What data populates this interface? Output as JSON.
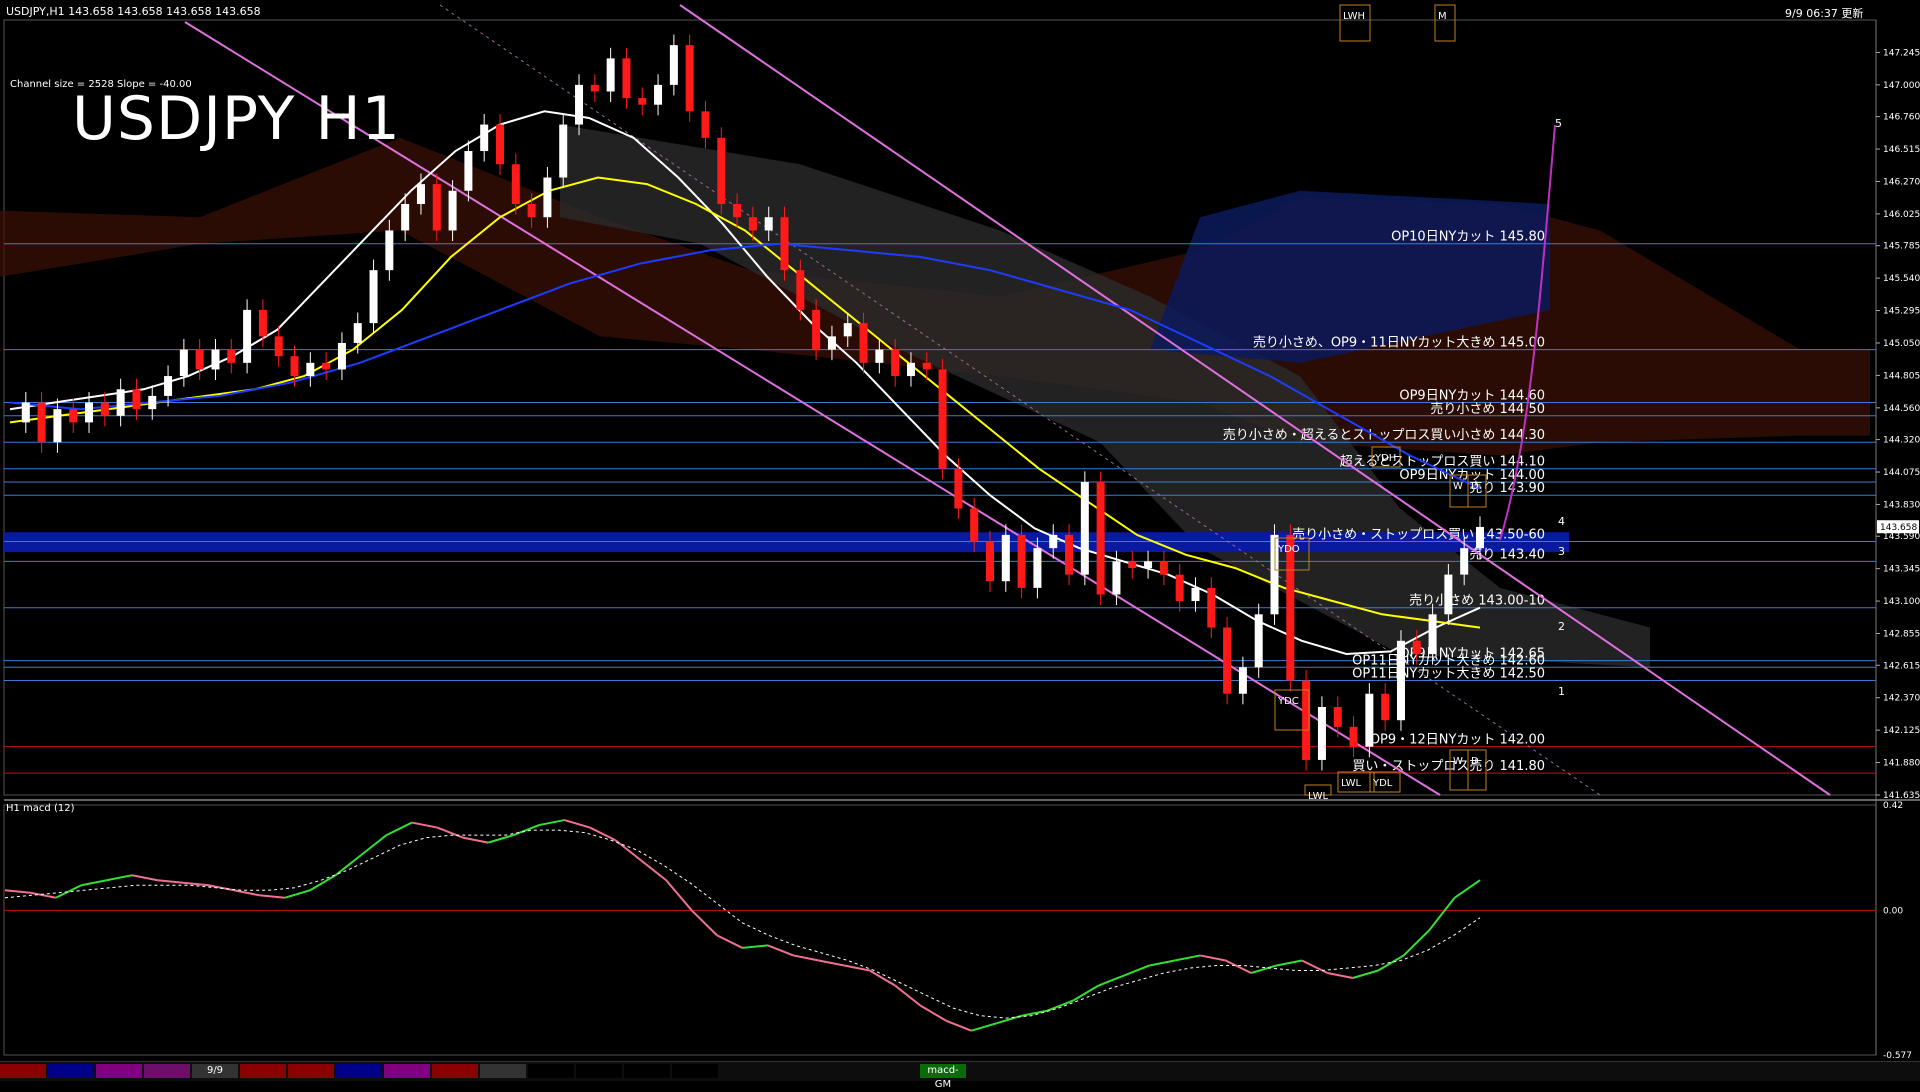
{
  "header": {
    "symbol_info": "USDJPY,H1  143.658 143.658 143.658 143.658",
    "datetime": "9/9 06:37 更新",
    "title": "USDJPY H1",
    "channel_info": "Channel size = 2528  Slope = -40.00"
  },
  "chart_data": [
    {
      "type": "line",
      "title": "USDJPY H1",
      "price_axis": {
        "range": [
          141.635,
          147.49
        ],
        "ticks": [
          "147.245",
          "147.000",
          "146.760",
          "146.515",
          "146.270",
          "146.025",
          "145.785",
          "145.540",
          "145.295",
          "145.050",
          "144.805",
          "144.560",
          "144.320",
          "144.075",
          "143.830",
          "143.590",
          "143.345",
          "143.100",
          "142.855",
          "142.615",
          "142.370",
          "142.125",
          "141.880",
          "141.635"
        ],
        "current_price": "143.658"
      },
      "price_path": [
        144.45,
        144.6,
        144.3,
        144.55,
        144.45,
        144.6,
        144.5,
        144.7,
        144.55,
        144.65,
        144.8,
        145.0,
        144.85,
        145.0,
        144.9,
        145.3,
        145.1,
        144.95,
        144.8,
        144.9,
        144.85,
        145.05,
        145.2,
        145.6,
        145.9,
        146.1,
        146.25,
        145.9,
        146.2,
        146.5,
        146.7,
        146.4,
        146.1,
        146.0,
        146.3,
        146.7,
        147.0,
        146.95,
        147.2,
        146.9,
        146.85,
        147.0,
        147.3,
        146.8,
        146.6,
        146.1,
        146.0,
        145.9,
        146.0,
        145.6,
        145.3,
        145.0,
        145.1,
        145.2,
        144.9,
        145.0,
        144.8,
        144.9,
        144.85,
        144.1,
        143.8,
        143.55,
        143.25,
        143.6,
        143.2,
        143.5,
        143.6,
        143.3,
        144.0,
        143.15,
        143.4,
        143.35,
        143.4,
        143.3,
        143.1,
        143.2,
        142.9,
        142.4,
        142.6,
        143.0,
        143.6,
        142.5,
        141.9,
        142.3,
        142.15,
        142.0,
        142.4,
        142.2,
        142.8,
        142.7,
        143.0,
        143.3,
        143.5,
        143.66
      ],
      "series": [
        {
          "color": "#ffffff",
          "values": [
            144.55,
            144.6,
            144.65,
            144.7,
            144.8,
            144.95,
            145.15,
            145.5,
            145.85,
            146.2,
            146.5,
            146.7,
            146.8,
            146.75,
            146.6,
            146.3,
            145.95,
            145.55,
            145.2,
            144.9,
            144.55,
            144.2,
            143.9,
            143.65,
            143.5,
            143.4,
            143.3,
            143.15,
            142.95,
            142.8,
            142.7,
            142.72,
            142.9,
            143.05
          ]
        },
        {
          "color": "#ffff00",
          "values": [
            144.45,
            144.5,
            144.55,
            144.6,
            144.65,
            144.7,
            144.8,
            145.0,
            145.3,
            145.7,
            146.0,
            146.2,
            146.3,
            146.25,
            146.1,
            145.9,
            145.6,
            145.3,
            145.0,
            144.7,
            144.4,
            144.1,
            143.85,
            143.6,
            143.45,
            143.35,
            143.2,
            143.1,
            143.0,
            142.95,
            142.9
          ]
        },
        {
          "color": "#1e3cff",
          "values": [
            144.6,
            144.55,
            144.6,
            144.65,
            144.75,
            144.9,
            145.1,
            145.3,
            145.5,
            145.65,
            145.75,
            145.8,
            145.75,
            145.7,
            145.6,
            145.45,
            145.3,
            145.05,
            144.8,
            144.5,
            144.2,
            143.95
          ]
        }
      ],
      "levels": [
        {
          "label": "OP10日NYカット 145.80",
          "price": 145.8
        },
        {
          "label": "売り小さめ、OP9・11日NYカット大きめ 145.00",
          "price": 145.0
        },
        {
          "label": "OP9日NYカット 144.60",
          "price": 144.6
        },
        {
          "label": "売り小さめ 144.50",
          "price": 144.5
        },
        {
          "label": "売り小さめ・超えるとストップロス買い小さめ 144.30",
          "price": 144.3
        },
        {
          "label": "超えるとストップロス買い 144.10",
          "price": 144.1
        },
        {
          "label": "OP9日NYカット 144.00",
          "price": 144.0
        },
        {
          "label": "売り 143.90",
          "price": 143.9
        },
        {
          "label": "売り小さめ・ストップロス買い 143.50-60",
          "price": 143.55
        },
        {
          "label": "売り 143.40",
          "price": 143.4
        },
        {
          "label": "売り小さめ 143.00-10",
          "price": 143.05
        },
        {
          "label": "OP9日NYカット 142.65",
          "price": 142.65
        },
        {
          "label": "OP11日NYカット大きめ 142.60",
          "price": 142.6
        },
        {
          "label": "OP11日NYカット大きめ 142.50",
          "price": 142.5
        },
        {
          "label": "OP9・12日NYカット 142.00",
          "price": 142.0
        },
        {
          "label": "買い・ストップロス売り 141.80",
          "price": 141.8
        }
      ],
      "wave_labels": [
        "5",
        "4",
        "3",
        "2",
        "1"
      ],
      "marker_boxes": [
        "LWH",
        "M",
        "YDH",
        "W",
        "D",
        "YDO",
        "YDC",
        "LWL",
        "YDL",
        "W",
        "D",
        "LWL"
      ]
    },
    {
      "type": "line",
      "title": "H1 macd (12)",
      "ylim": [
        -0.577,
        0.42
      ],
      "ticks": [
        "0.42",
        "0.00",
        "-0.577"
      ],
      "macd": [
        0.08,
        0.07,
        0.05,
        0.1,
        0.12,
        0.14,
        0.12,
        0.11,
        0.1,
        0.08,
        0.06,
        0.05,
        0.08,
        0.14,
        0.22,
        0.3,
        0.35,
        0.33,
        0.29,
        0.27,
        0.3,
        0.34,
        0.36,
        0.33,
        0.28,
        0.2,
        0.12,
        0.0,
        -0.1,
        -0.15,
        -0.14,
        -0.18,
        -0.2,
        -0.22,
        -0.24,
        -0.3,
        -0.38,
        -0.44,
        -0.48,
        -0.45,
        -0.42,
        -0.4,
        -0.36,
        -0.3,
        -0.26,
        -0.22,
        -0.2,
        -0.18,
        -0.2,
        -0.25,
        -0.22,
        -0.2,
        -0.25,
        -0.27,
        -0.24,
        -0.18,
        -0.08,
        0.05,
        0.12
      ],
      "signal": [
        0.05,
        0.06,
        0.07,
        0.08,
        0.09,
        0.1,
        0.1,
        0.1,
        0.09,
        0.08,
        0.08,
        0.09,
        0.12,
        0.16,
        0.21,
        0.26,
        0.29,
        0.3,
        0.3,
        0.3,
        0.32,
        0.32,
        0.31,
        0.28,
        0.24,
        0.18,
        0.11,
        0.03,
        -0.05,
        -0.1,
        -0.14,
        -0.17,
        -0.2,
        -0.24,
        -0.29,
        -0.34,
        -0.39,
        -0.42,
        -0.43,
        -0.42,
        -0.39,
        -0.35,
        -0.31,
        -0.28,
        -0.25,
        -0.23,
        -0.22,
        -0.22,
        -0.23,
        -0.24,
        -0.24,
        -0.23,
        -0.22,
        -0.2,
        -0.16,
        -0.1,
        -0.03
      ]
    }
  ],
  "taskbar": {
    "tabs": [
      "",
      "",
      "",
      "",
      "9/9",
      "",
      "",
      "",
      "",
      "",
      "",
      "",
      "",
      "",
      "",
      "macd-GM"
    ],
    "colors": [
      "#8b0000",
      "#00008b",
      "#800080",
      "#6b0f6b",
      "#333333",
      "#8b0000",
      "#8b0000",
      "#00008b",
      "#800080",
      "#8b0000",
      "#333333",
      "#000000",
      "#000000",
      "#000000",
      "#000000",
      "#0a6b0a"
    ]
  }
}
